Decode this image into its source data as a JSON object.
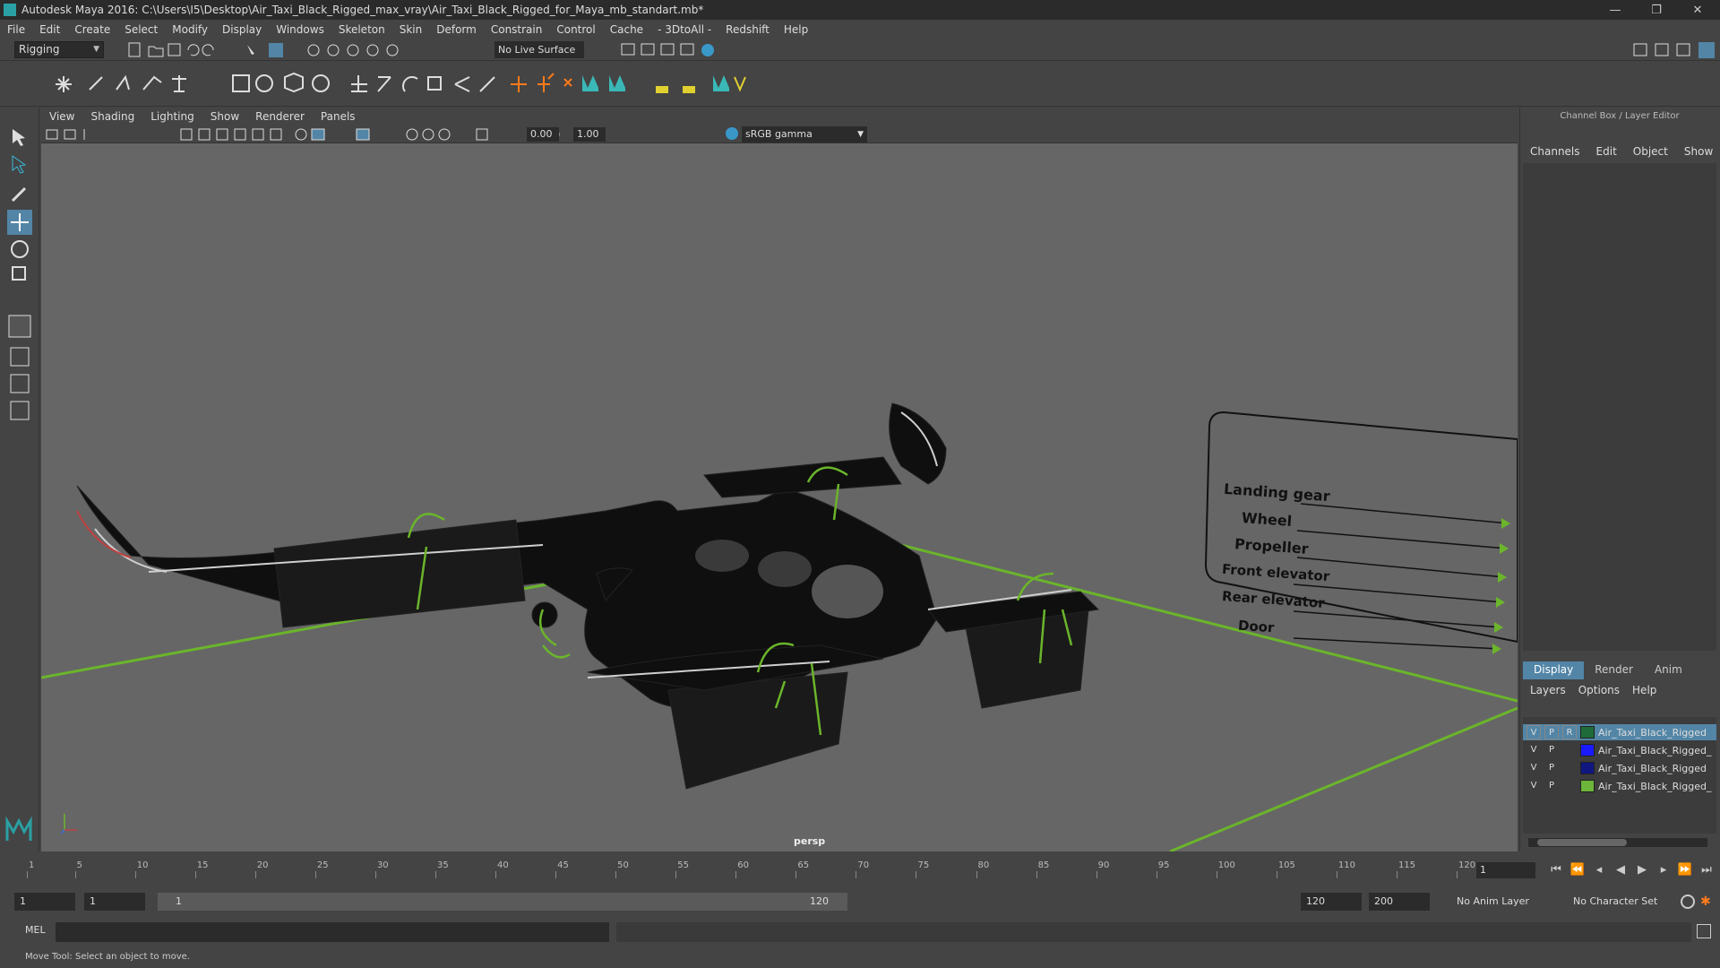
{
  "window": {
    "title": "Autodesk Maya 2016: C:\\Users\\I5\\Desktop\\Air_Taxi_Black_Rigged_max_vray\\Air_Taxi_Black_Rigged_for_Maya_mb_standart.mb*",
    "minimize": "—",
    "restore": "❐",
    "close": "✕"
  },
  "menubar": [
    "File",
    "Edit",
    "Create",
    "Select",
    "Modify",
    "Display",
    "Windows",
    "Skeleton",
    "Skin",
    "Deform",
    "Constrain",
    "Control",
    "Cache",
    "- 3DtoAll -",
    "Redshift",
    "Help"
  ],
  "statusline": {
    "mode": "Rigging",
    "live_surface": "No Live Surface"
  },
  "panel": {
    "menu": [
      "View",
      "Shading",
      "Lighting",
      "Show",
      "Renderer",
      "Panels"
    ],
    "exposure": "0.00",
    "gamma_value": "1.00",
    "color_space": "sRGB gamma",
    "camera_label": "persp"
  },
  "rig_labels": [
    "Landing gear",
    "Wheel",
    "Propeller",
    "Front elevator",
    "Rear elevator",
    "Door"
  ],
  "right_panel": {
    "header": "Channel Box / Layer Editor",
    "menu": [
      "Channels",
      "Edit",
      "Object",
      "Show"
    ],
    "tabs": [
      "Display",
      "Render",
      "Anim"
    ],
    "active_tab": "Display",
    "layer_menu": [
      "Layers",
      "Options",
      "Help"
    ],
    "layers": [
      {
        "v": "V",
        "p": "P",
        "r": "R",
        "name": "Air_Taxi_Black_Rigged",
        "color": "#1f6b3a",
        "selected": true
      },
      {
        "v": "V",
        "p": "P",
        "r": "",
        "name": "Air_Taxi_Black_Rigged_",
        "color": "#1a1aff",
        "selected": false
      },
      {
        "v": "V",
        "p": "P",
        "r": "",
        "name": "Air_Taxi_Black_Rigged",
        "color": "#101880",
        "selected": false
      },
      {
        "v": "V",
        "p": "P",
        "r": "",
        "name": "Air_Taxi_Black_Rigged_",
        "color": "#6cb43a",
        "selected": false
      }
    ]
  },
  "timeline": {
    "ticks": [
      "1",
      "5",
      "10",
      "15",
      "20",
      "25",
      "30",
      "35",
      "40",
      "45",
      "50",
      "55",
      "60",
      "65",
      "70",
      "75",
      "80",
      "85",
      "90",
      "95",
      "100",
      "105",
      "110",
      "115",
      "120"
    ],
    "current_frame": "1"
  },
  "range": {
    "start": "1",
    "start2": "1",
    "slider_start": "1",
    "slider_end": "120",
    "end": "120",
    "end2": "200",
    "anim_layer": "No Anim Layer",
    "character_set": "No Character Set"
  },
  "mel": {
    "label": "MEL"
  },
  "help": "Move Tool: Select an object to move."
}
